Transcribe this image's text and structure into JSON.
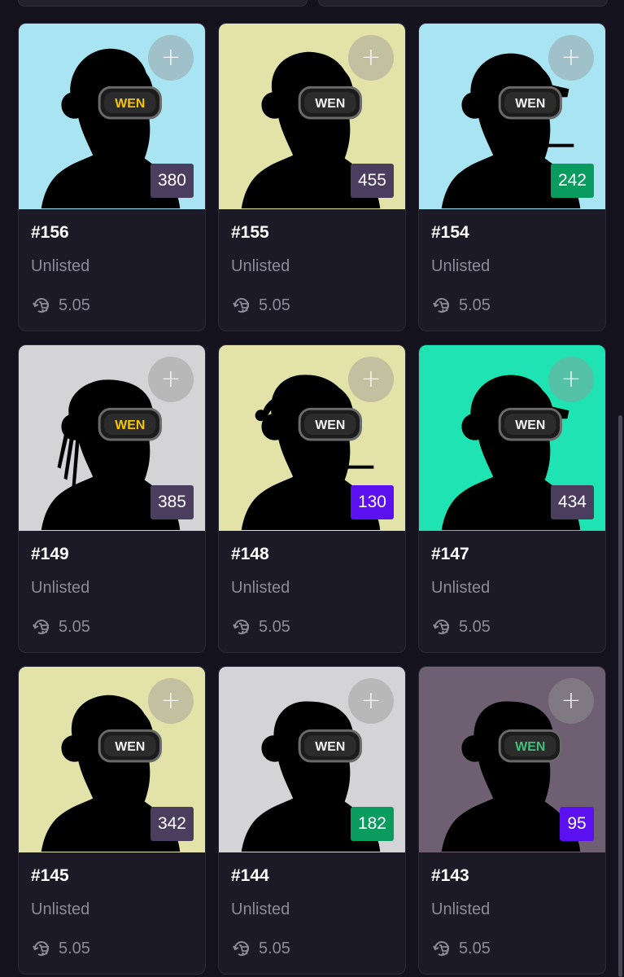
{
  "cards": [
    {
      "id": "#156",
      "status": "Unlisted",
      "price": "5.05",
      "rank": "380",
      "bg": "#a8e4f2",
      "rank_color": "#4a3d5e",
      "lens_color": "#f6c400",
      "hat": "beanie",
      "cig": false
    },
    {
      "id": "#155",
      "status": "Unlisted",
      "price": "5.05",
      "rank": "455",
      "bg": "#e3e2a8",
      "rank_color": "#4a3d5e",
      "lens_color": "#f2f2f2",
      "hat": "cap-wen",
      "cig": false
    },
    {
      "id": "#154",
      "status": "Unlisted",
      "price": "5.05",
      "rank": "242",
      "bg": "#a8e4f2",
      "rank_color": "#0a9b5e",
      "lens_color": "#f2f2f2",
      "hat": "cap",
      "cig": true
    },
    {
      "id": "#149",
      "status": "Unlisted",
      "price": "5.05",
      "rank": "385",
      "bg": "#d4d4d6",
      "rank_color": "#4a3d5e",
      "lens_color": "#f6c400",
      "hat": "dreads",
      "cig": false
    },
    {
      "id": "#148",
      "status": "Unlisted",
      "price": "5.05",
      "rank": "130",
      "bg": "#e3e2a8",
      "rank_color": "#5b10f0",
      "lens_color": "#f2f2f2",
      "hat": "santa",
      "cig": true
    },
    {
      "id": "#147",
      "status": "Unlisted",
      "price": "5.05",
      "rank": "434",
      "bg": "#1fe3b2",
      "rank_color": "#4a3d5e",
      "lens_color": "#f2f2f2",
      "hat": "cap",
      "cig": false
    },
    {
      "id": "#145",
      "status": "Unlisted",
      "price": "5.05",
      "rank": "342",
      "bg": "#e3e2a8",
      "rank_color": "#4a3d5e",
      "lens_color": "#f2f2f2",
      "hat": "cap-wen",
      "cig": false
    },
    {
      "id": "#144",
      "status": "Unlisted",
      "price": "5.05",
      "rank": "182",
      "bg": "#d4d4d6",
      "rank_color": "#0a9b5e",
      "lens_color": "#f2f2f2",
      "hat": "none",
      "cig": false
    },
    {
      "id": "#143",
      "status": "Unlisted",
      "price": "5.05",
      "rank": "95",
      "bg": "#6e5f72",
      "rank_color": "#5b10f0",
      "lens_color": "#3fc27a",
      "hat": "none",
      "cig": false
    }
  ],
  "icons": {
    "add": "plus-icon",
    "price": "cart-refresh-icon"
  },
  "goggle_text": "WEN",
  "cap_text": "WEN"
}
